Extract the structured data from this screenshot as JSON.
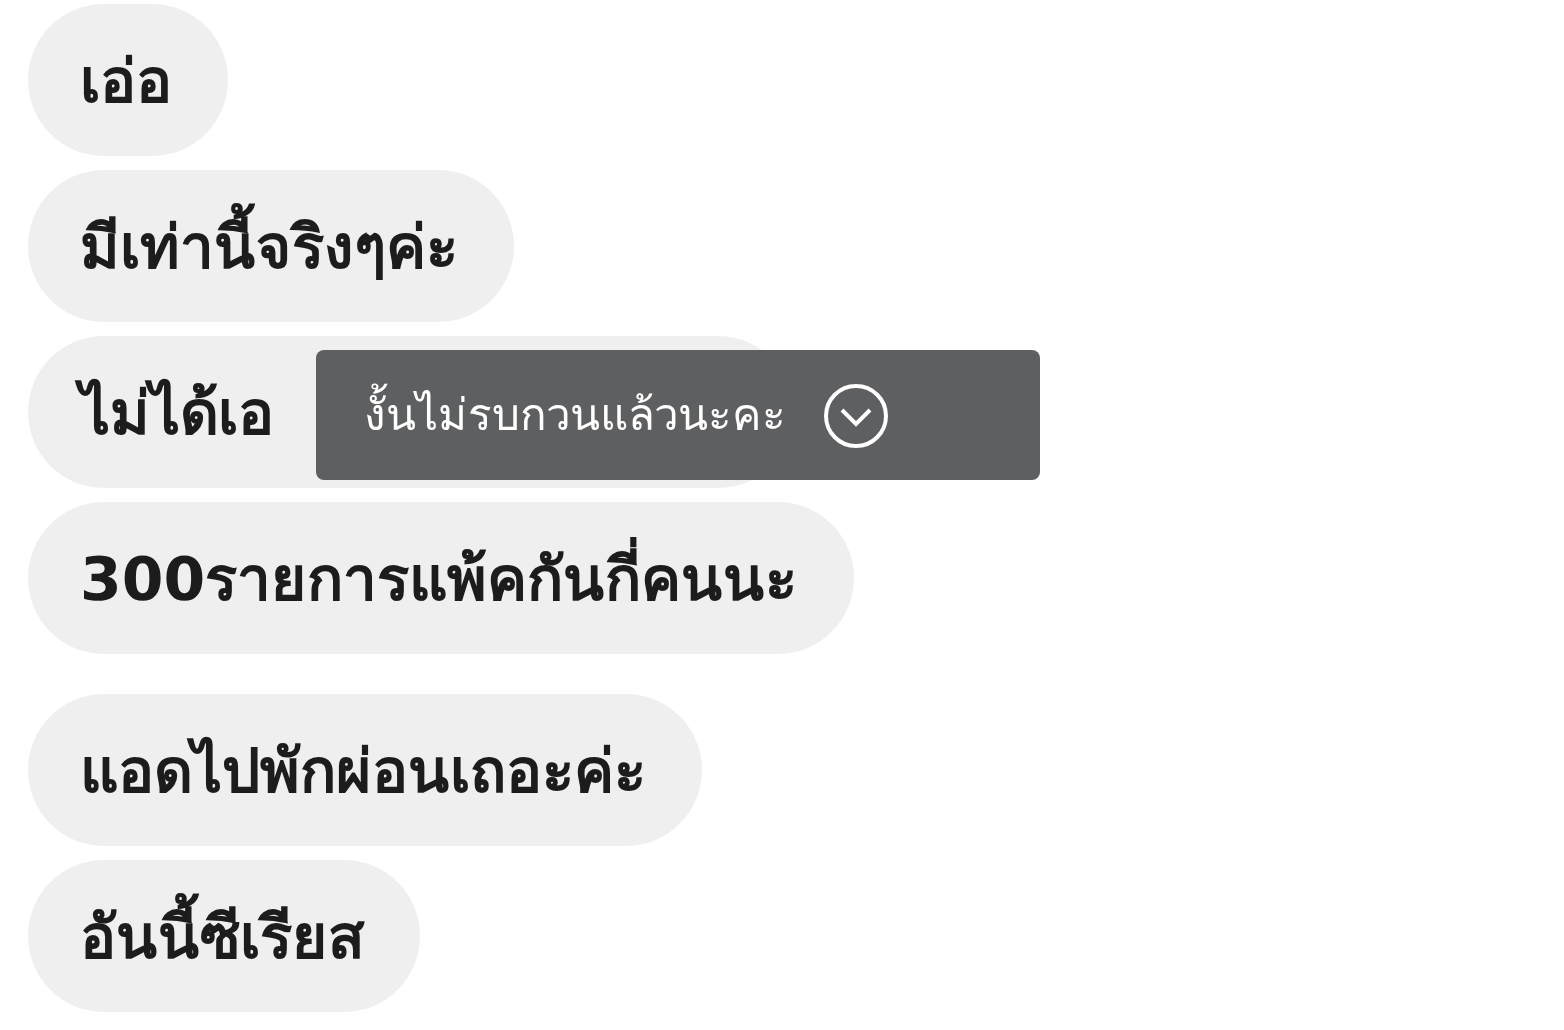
{
  "message_groups": [
    {
      "messages": [
        {
          "text": "เอ่อ"
        },
        {
          "text": "มีเท่านี้จริงๆค่ะ"
        },
        {
          "text": "ไม่ได้เอ",
          "covered": true
        },
        {
          "text": "300รายการแพ้คกันกี่คนนะ"
        }
      ]
    },
    {
      "messages": [
        {
          "text": "แอดไปพักผ่อนเถอะค่ะ"
        },
        {
          "text": "อันนี้ซีเรียส"
        }
      ]
    }
  ],
  "tooltip": {
    "text": "งั้นไม่รบกวนแล้วนะคะ"
  }
}
